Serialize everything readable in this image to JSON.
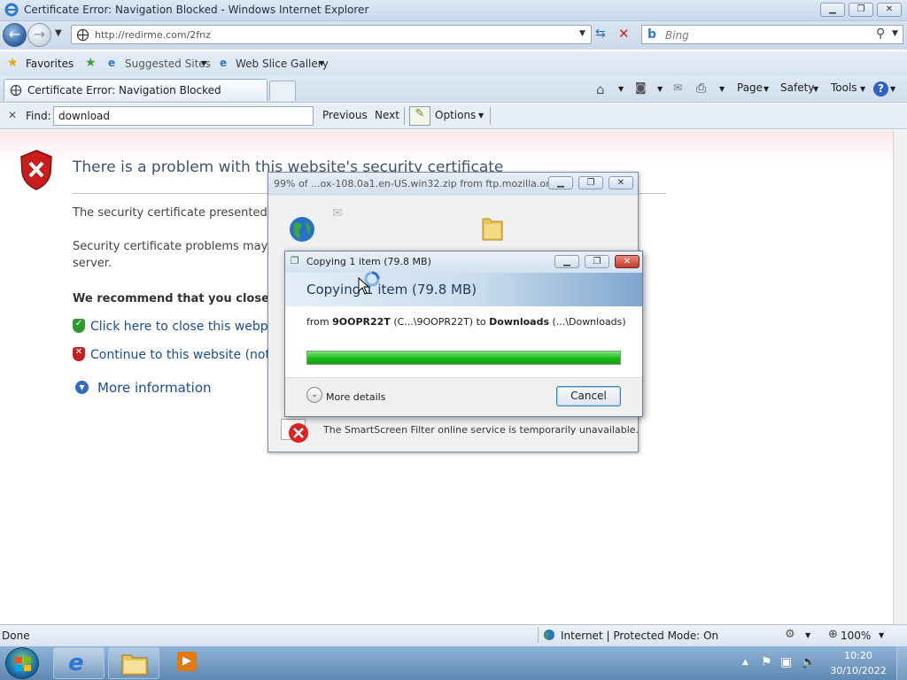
{
  "window": {
    "title": "Certificate Error: Navigation Blocked - Windows Internet Explorer"
  },
  "nav": {
    "address": "http://redirme.com/2fnz",
    "search_placeholder": "Bing"
  },
  "favorites": {
    "favorites_label": "Favorites",
    "suggested_sites": "Suggested Sites",
    "web_slice_gallery": "Web Slice Gallery"
  },
  "tab": {
    "label": "Certificate Error: Navigation Blocked"
  },
  "commandbar": {
    "page": "Page",
    "safety": "Safety",
    "tools": "Tools"
  },
  "findbar": {
    "label": "Find:",
    "value": "download",
    "previous": "Previous",
    "next": "Next",
    "options": "Options"
  },
  "cert_page": {
    "heading": "There is a problem with this website's security certificate",
    "line1": "The security certificate presented by",
    "line2": "Security certificate problems may ind",
    "line3": "server.",
    "recommend": "We recommend that you close th",
    "close_link": "Click here to close this webpage.",
    "continue_link": "Continue to this website (not rec",
    "more_info": "More information"
  },
  "download_dialog": {
    "title": "99% of ...ox-108.0a1.en-US.win32.zip from ftp.mozilla.or...",
    "smartscreen": "The SmartScreen Filter online service is temporarily unavailable."
  },
  "copy_dialog": {
    "title": "Copying 1 item (79.8 MB)",
    "banner": "Copying 1 item (79.8 MB)",
    "from_label": "from",
    "from_name": "9OOPR22T",
    "from_path": "(C...\\9OOPR22T)",
    "to_label": "to",
    "to_name": "Downloads",
    "to_path": "(...\\Downloads)",
    "progress": 1.0,
    "more_details": "More details",
    "cancel": "Cancel"
  },
  "status": {
    "left": "Done",
    "zone": "Internet | Protected Mode: On",
    "zoom": "100%"
  },
  "clock": {
    "time": "10:20",
    "date": "30/10/2022"
  }
}
